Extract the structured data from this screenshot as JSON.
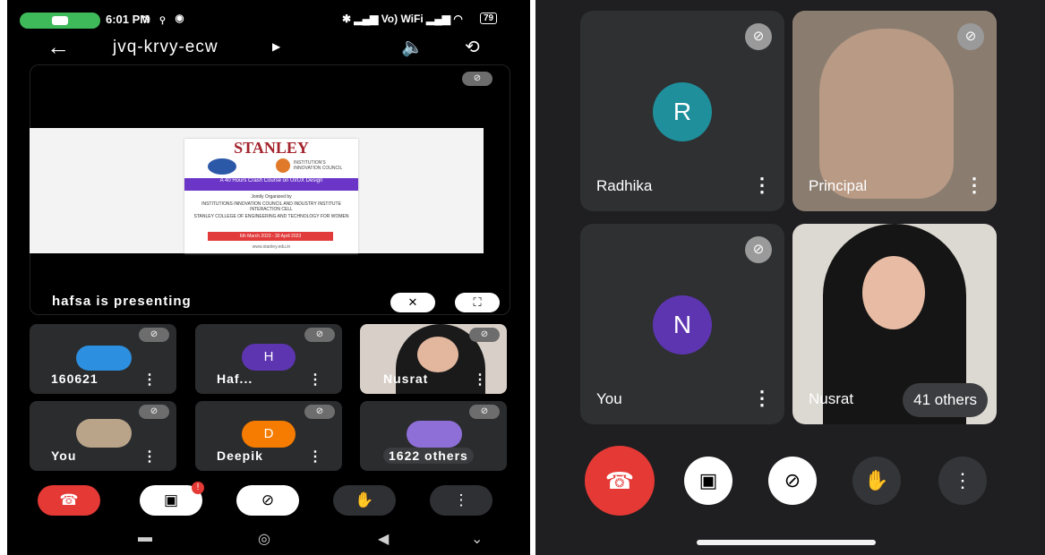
{
  "left": {
    "status": {
      "time": "6:01 PM",
      "right_text": "Vo) WiFi",
      "battery": "79"
    },
    "meeting_code": "jvq-krvy-ecw",
    "slide": {
      "brand": "STANLEY",
      "iic_label": "INSTITUTION'S INNOVATION COUNCIL",
      "band": "A 40 Hours Crash Course on UI/UX Design",
      "line1": "Jointly Organized by",
      "line2": "INSTITUTIONS INNOVATION COUNCIL AND INDUSTRY INSTITUTE INTERACTION CELL",
      "line3": "STANLEY COLLEGE OF ENGINEERING AND TECHNOLOGY FOR WOMEN",
      "dates": "6th March 2023 - 30 April 2023",
      "url": "www.stanley.edu.in"
    },
    "presenting": "hafsa is presenting",
    "tiles": [
      {
        "name": "160621",
        "avatar": "",
        "color": "#2c8fe0"
      },
      {
        "name": "Haf...",
        "avatar": "H",
        "color": "#5e35b1"
      },
      {
        "name": "Nusrat",
        "avatar": "",
        "color": ""
      },
      {
        "name": "You",
        "avatar": "",
        "color": ""
      },
      {
        "name": "Deepik",
        "avatar": "D",
        "color": "#f57c00"
      },
      {
        "name": "1622 others",
        "avatar": "",
        "color": "#8e6fd8"
      }
    ]
  },
  "right": {
    "tiles": [
      {
        "name": "Radhika",
        "avatar": "R",
        "color": "#1f8f9c"
      },
      {
        "name": "Principal",
        "avatar": "",
        "color": ""
      },
      {
        "name": "You",
        "avatar": "N",
        "color": "#5e35b1"
      },
      {
        "name": "Nusrat",
        "avatar": "",
        "color": ""
      }
    ],
    "others": "41 others"
  },
  "colors": {
    "end_call": "#e53935",
    "tile_bg": "#2b2c2e",
    "panel_bg": "#1f1f21"
  },
  "icons": [
    "back-arrow-icon",
    "speaker-icon",
    "camera-flip-icon",
    "mic-off-icon",
    "pin-off-icon",
    "fullscreen-icon",
    "more-vert-icon",
    "end-call-icon",
    "camera-off-icon",
    "raise-hand-icon"
  ]
}
